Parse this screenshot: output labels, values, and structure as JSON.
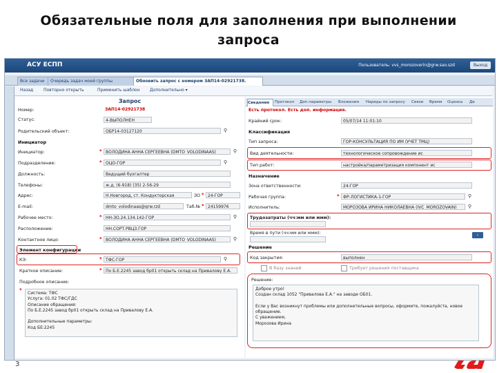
{
  "slide": {
    "title_line1": "Обязательные поля для заполнения при выполнении",
    "title_line2": "запроса",
    "page_number": "3"
  },
  "app": {
    "name": "АСУ ЕСПП",
    "user_text": "Пользователь: vvs_morozoverin@grw.sao.szd",
    "exit_label": "Выход"
  },
  "tabs": [
    "Все задачи",
    "Очередь задач моей группы",
    "Обновить запрос с номером ЗАП14-02921738."
  ],
  "toolbar": [
    "Назад",
    "Повторно открыть",
    "Применить шаблон",
    "Дополнительно ▾"
  ],
  "left": {
    "panel_title": "Запрос",
    "number_label": "Номер:",
    "number_value": "ЗАП14-02921738",
    "status_label": "Статус:",
    "status_value": "4-ВЫПОЛНЕН",
    "parent_label": "Родительский объект:",
    "parent_value": "ОБР14-03127120",
    "initiator_section": "Инициатор",
    "initiator_label": "Инициатор:",
    "initiator_value": "ВОЛОДИНА АННА СЕРГЕЕВНА (DMTO_VOLODINAAS)",
    "division_label": "Подразделение:",
    "division_value": "ОЦО-ГОР",
    "position_label": "Должность:",
    "position_value": "Ведущий бухгалтер",
    "phones_label": "Телефоны:",
    "phones_value": "ж.д. (6-918) (35) 2-56-29",
    "address_label": "Адрес:",
    "address_value": "Н.Новгород, ст. Кондукторская",
    "zo_label": "ЗО",
    "zo_value": "24-ГОР",
    "email_label": "E-mail:",
    "email_value": "dmto_volodinaas@grw.rzd",
    "tab_label": "Таб.№",
    "tab_value": "24159976",
    "workplace_label": "Рабочее место:",
    "workplace_value": "НН-ЗО.24.134.142-ГОР",
    "location_label": "Расположение:",
    "location_value": "НН.СОРТ.РВЦЗ.ГОР",
    "contact_label": "Контактное лицо:",
    "contact_value": "ВОЛОДИНА АННА СЕРГЕЕВНА (DMTO_VOLODINAAS)",
    "config_section": "Элемент конфигурации",
    "ke_label": "КЭ:",
    "ke_value": "ТФС-ГОР",
    "short_label": "Краткое описание:",
    "short_value": "По Б.Е.2245 завод бр01 открыть склад на Привалову Е.А.",
    "detail_label": "Подробное описание:",
    "detail_lines": [
      "Система: ТФС",
      "Услуга: 01.02 ТФС/ГДС",
      "Описание обращения:",
      "По Б.Е.2245 завод бр01 открыть склад на Привалову Е.А.",
      "",
      "Дополнительные параметры:",
      "Код БЕ:2245"
    ]
  },
  "right": {
    "tabs": [
      "Сведения",
      "Протокол",
      "Доп.параметры",
      "Вложения",
      "Наряды по запросу",
      "Связи",
      "Время",
      "Оценка",
      "Де"
    ],
    "protocol_warning": "Есть протокол. Есть доп. информация.",
    "deadline_label": "Крайний срок:",
    "deadline_value": "05/07/14 11:01:10",
    "class_section": "Классификация",
    "req_type_label": "Тип запроса:",
    "req_type_value": "ГОР-КОНСУЛЬТАЦИЯ ПО ИМ (УЧЕТ ТМЦ)",
    "activity_label": "Вид деятельности:",
    "activity_value": "технологическое сопровождение ис",
    "worktype_label": "Тип работ:",
    "worktype_value": "настройка/параметризация компонент ис",
    "assign_section": "Назначение",
    "zone_label": "Зона ответственности:",
    "zone_value": "24-ГОР",
    "group_label": "Рабочая группа:",
    "group_value": "ФР-ЛОГИСТИКА-1-ГОР",
    "executor_label": "Исполнитель:",
    "executor_value": "МОРОЗОВА ИРИНА НИКОЛАЕВНА (IVC_MOROZOVAIN)",
    "labor_label": "Трудозатраты (чч:мм или ммм):",
    "labor_value": "",
    "waittime_label": "Время в пути (чч:мм или ммм):",
    "waittime_value": "",
    "decision_section": "Решение",
    "close_code_label": "Код закрытия:",
    "close_code_value": "выполнен",
    "kb_label": "В базу знаний",
    "vend_label": "Требует решения поставщика",
    "solution_label": "Решение:",
    "solution_lines": [
      "Доброе утро!",
      "Создан склад 1052 \"Привалова Е.А.\" на заводе ОБ01.",
      "",
      "Если у Вас возникнут проблемы или дополнительные вопросы, оформите, пожалуйста, новое",
      "обращение.",
      "С уважением,",
      "Морозова Ирина"
    ]
  },
  "colors": {
    "highlight": "#d22222",
    "header": "#1d477a",
    "accent_red": "#cc0000"
  },
  "icons": [
    "search-icon",
    "rzd-logo"
  ]
}
